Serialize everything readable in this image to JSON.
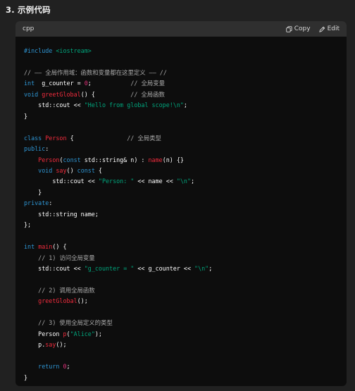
{
  "heading": "3. 示例代码",
  "code_block": {
    "language": "cpp",
    "copy_label": "Copy",
    "edit_label": "Edit",
    "copy_icon": "copy-icon",
    "edit_icon": "pencil-icon"
  },
  "code": {
    "include_directive": "#include",
    "include_header": "<iostream>",
    "comment_global_scope": "// —— 全局作用域：函数和变量都在这里定义 —— //",
    "kw_int": "int",
    "g_counter_decl": "g_counter = ",
    "num_zero": "0",
    "semicolon": ";",
    "comment_global_var": "// 全局变量",
    "kw_void": "void",
    "fn_greetGlobal": "greetGlobal",
    "parens_brace": "() {",
    "comment_global_fn": "// 全局函数",
    "std_cout": "std::cout << ",
    "str_hello": "\"Hello from global scope!\\n\"",
    "close_brace": "}",
    "kw_class": "class",
    "cls_Person": "Person",
    "open_brace": " {",
    "comment_global_type": "// 全局类型",
    "kw_public": "public",
    "colon": ":",
    "ctor_Person": "Person",
    "paren_open": "(",
    "kw_const": "const",
    "ctor_params": " std::string& n) : ",
    "fn_name": "name",
    "ctor_tail": "(n) {}",
    "fn_say": "say",
    "say_parens": "() ",
    "say_const_tail": " {",
    "str_person": "\"Person: \"",
    "cout_mid": " << name << ",
    "str_newline": "\"\\n\"",
    "close_brace_semi": "};",
    "kw_private": "private",
    "string_name_decl": "std::string name;",
    "fn_main": "main",
    "comment_step1": "// 1) 访问全局变量",
    "str_g_counter": "\"g_counter = \"",
    "cout_g_counter": " << g_counter << ",
    "comment_step2": "// 2) 调用全局函数",
    "call_greetGlobal": "greetGlobal",
    "call_tail": "();",
    "comment_step3": "// 3) 使用全局定义的类型",
    "person_decl": "Person ",
    "var_p": "p",
    "str_alice": "\"Alice\"",
    "paren_close_semi": ");",
    "p_dot": "p.",
    "kw_return": "return"
  }
}
